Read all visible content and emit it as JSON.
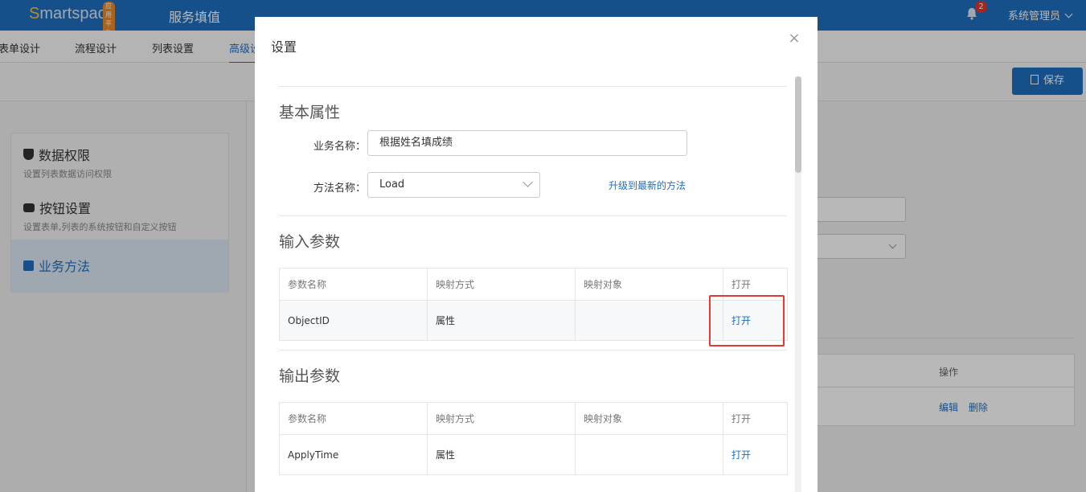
{
  "header": {
    "logo_s": "S",
    "logo_rest": "martspace",
    "logo_badge": "应用平台",
    "app_title": "服务填值",
    "notification_count": "2",
    "user_name": "系统管理员"
  },
  "subnav": {
    "tabs": [
      "表单设计",
      "流程设计",
      "列表设置",
      "高级设"
    ]
  },
  "toolbar": {
    "save_label": "保存"
  },
  "left_panel": {
    "items": [
      {
        "title": "数据权限",
        "subtitle": "设置列表数据访问权限"
      },
      {
        "title": "按钮设置",
        "subtitle": "设置表单,列表的系统按钮和自定义按钮"
      },
      {
        "title": "业务方法",
        "subtitle": ""
      }
    ]
  },
  "background_table": {
    "header_action": "操作",
    "edit_label": "编辑",
    "delete_label": "删除"
  },
  "modal": {
    "title": "设置",
    "close_glyph": "×",
    "basic": {
      "section_title": "基本属性",
      "business_name_label": "业务名称：",
      "business_name_value": "根据姓名填成绩",
      "method_name_label": "方法名称：",
      "method_name_value": "Load",
      "upgrade_link": "升级到最新的方法"
    },
    "input_params": {
      "section_title": "输入参数",
      "headers": [
        "参数名称",
        "映射方式",
        "映射对象",
        "打开"
      ],
      "rows": [
        {
          "name": "ObjectID",
          "mapping": "属性",
          "target": "",
          "action": "打开"
        }
      ]
    },
    "output_params": {
      "section_title": "输出参数",
      "headers": [
        "参数名称",
        "映射方式",
        "映射对象",
        "打开"
      ],
      "rows": [
        {
          "name": "ApplyTime",
          "mapping": "属性",
          "target": "",
          "action": "打开"
        }
      ]
    }
  },
  "colors": {
    "primary": "#1f6fbf",
    "highlight_box": "#e53935",
    "badge_red": "#e8322d"
  }
}
